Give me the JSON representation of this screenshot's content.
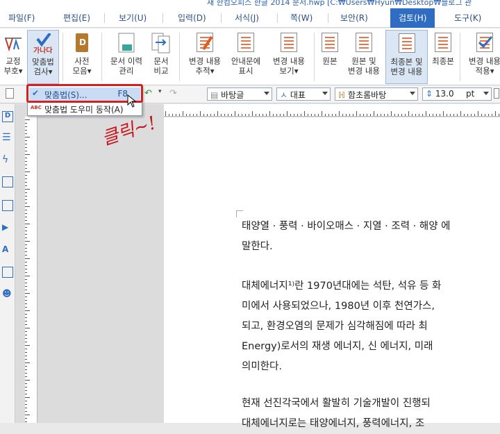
{
  "window": {
    "title": "새 한컴오피스 한글 2014 문서.hwp [C:₩Users₩Hyun₩Desktop₩블로그 관"
  },
  "menubar": {
    "items": [
      "파일(F)",
      "편집(E)",
      "보기(U)",
      "입력(D)",
      "서식(J)",
      "쪽(W)",
      "보안(R)",
      "검토(H)",
      "도구(K)"
    ],
    "active": "검토(H)"
  },
  "ribbon": {
    "buttons": [
      {
        "label1": "교정",
        "label2": "부호▾",
        "icon": "proofread-icon"
      },
      {
        "label1": "맞춤법",
        "label2": "검사▾",
        "icon": "spellcheck-icon"
      },
      {
        "label1": "사전",
        "label2": "모음▾",
        "icon": "dictionary-icon"
      },
      {
        "label1": "문서 이력",
        "label2": "관리",
        "icon": "history-icon"
      },
      {
        "label1": "문서",
        "label2": "비교",
        "icon": "compare-icon"
      },
      {
        "label1": "변경 내용",
        "label2": "추적▾",
        "icon": "track-changes-icon"
      },
      {
        "label1": "안내문에",
        "label2": "표시",
        "icon": "balloon-icon"
      },
      {
        "label1": "변경 내용",
        "label2": "보기▾",
        "icon": "view-changes-icon"
      },
      {
        "label1": "원본",
        "label2": "",
        "icon": "original-icon"
      },
      {
        "label1": "원본 및",
        "label2": "변경 내용",
        "icon": "original-changes-icon"
      },
      {
        "label1": "최종본 및",
        "label2": "변경 내용",
        "icon": "final-changes-icon"
      },
      {
        "label1": "최종본",
        "label2": "",
        "icon": "final-icon"
      },
      {
        "label1": "변경 내용",
        "label2": "적용▾",
        "icon": "apply-changes-icon"
      }
    ],
    "spell_icon_text": "가나다"
  },
  "toolbar2": {
    "style": "바탕글",
    "lang": "대표",
    "font": "함초롬바탕",
    "size": "13.0",
    "unit": "pt"
  },
  "dropdown": {
    "items": [
      {
        "label": "맞춤법(S)...",
        "shortcut": "F8"
      },
      {
        "label": "맞춤법 도우미 동작(A)",
        "shortcut": ""
      }
    ]
  },
  "annotation": "클릭~!",
  "document": {
    "paragraphs": [
      [
        "태양열 · 풍력 · 바이오매스 · 지열 · 조력 · 해양 에",
        "말한다."
      ],
      [
        "대체에너지¹⁾란 1970년대에는 석탄, 석유 등 화",
        "미에서 사용되었으나, 1980년 이후 천연가스,",
        "되고, 환경오염의 문제가 심각해짐에 따라 최",
        "Energy)로서의 재생 에너지, 신 에너지, 미래",
        "의미한다."
      ],
      [
        "현재 선진각국에서 활발히 기술개발이 진행되",
        "대체에너지로는 태양에너지, 풍력에너지, 조"
      ]
    ]
  },
  "colors": {
    "accent": "#2e6dc2",
    "menu_text": "#2b4f86",
    "highlight": "#d42020"
  }
}
